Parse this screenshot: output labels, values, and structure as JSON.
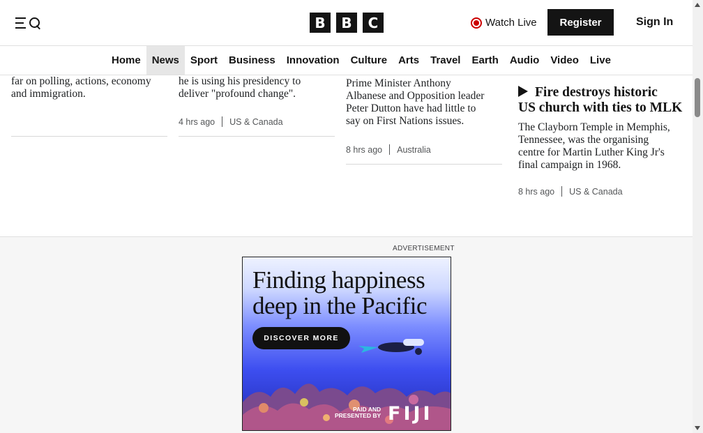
{
  "header": {
    "logo_letters": [
      "B",
      "B",
      "C"
    ],
    "watch_live": "Watch Live",
    "register": "Register",
    "sign_in": "Sign In"
  },
  "nav": {
    "items": [
      {
        "label": "Home",
        "active": false
      },
      {
        "label": "News",
        "active": true
      },
      {
        "label": "Sport",
        "active": false
      },
      {
        "label": "Business",
        "active": false
      },
      {
        "label": "Innovation",
        "active": false
      },
      {
        "label": "Culture",
        "active": false
      },
      {
        "label": "Arts",
        "active": false
      },
      {
        "label": "Travel",
        "active": false
      },
      {
        "label": "Earth",
        "active": false
      },
      {
        "label": "Audio",
        "active": false
      },
      {
        "label": "Video",
        "active": false
      },
      {
        "label": "Live",
        "active": false
      }
    ]
  },
  "articles": [
    {
      "summary_lines": [
        "far on polling, actions, economy",
        "and immigration."
      ]
    },
    {
      "summary_lines": [
        "he is using his presidency to",
        "deliver \"profound change\"."
      ],
      "time": "4 hrs ago",
      "section": "US & Canada"
    },
    {
      "summary_lines": [
        "Prime Minister Anthony",
        "Albanese and Opposition leader",
        "Peter Dutton have had little to",
        "say on First Nations issues."
      ],
      "time": "8 hrs ago",
      "section": "Australia"
    },
    {
      "headline_lines": [
        "Fire destroys historic",
        "US church with ties to MLK"
      ],
      "summary_lines": [
        "The Clayborn Temple in Memphis,",
        "Tennessee, was the organising",
        "centre for Martin Luther King Jr's",
        "final campaign in 1968."
      ],
      "time": "8 hrs ago",
      "section": "US & Canada",
      "icon": "play-icon"
    }
  ],
  "ad": {
    "label": "ADVERTISEMENT",
    "title_lines": [
      "Finding happiness",
      "deep in the Pacific"
    ],
    "cta": "DISCOVER MORE",
    "paid_lines": [
      "PAID AND",
      "PRESENTED BY"
    ],
    "brand": "FIJI"
  },
  "colors": {
    "live_red": "#cc0000",
    "nav_active_bg": "#e6e6e6",
    "ink": "#141414"
  }
}
